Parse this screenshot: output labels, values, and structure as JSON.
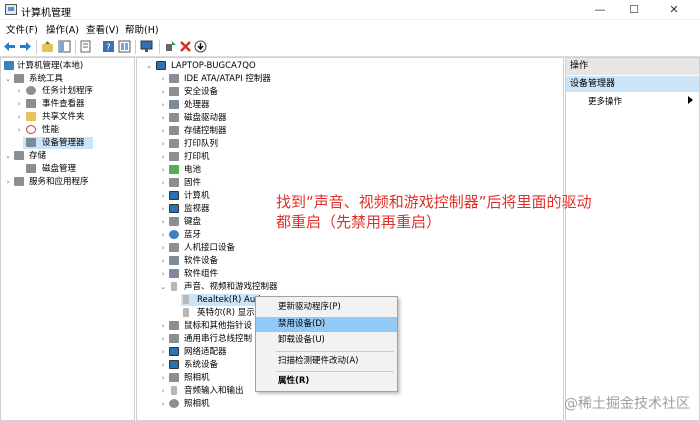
{
  "window": {
    "title": "计算机管理",
    "minimize": "—",
    "maximize": "☐",
    "close": "✕"
  },
  "menu": [
    "文件(F)",
    "操作(A)",
    "查看(V)",
    "帮助(H)"
  ],
  "left_tree": [
    {
      "label": "计算机管理(本地)",
      "icon": "computer-management-icon"
    },
    {
      "label": "系统工具",
      "icon": "tools-icon"
    },
    {
      "label": "任务计划程序",
      "icon": "clock-icon"
    },
    {
      "label": "事件查看器",
      "icon": "event-viewer-icon"
    },
    {
      "label": "共享文件夹",
      "icon": "folder-icon"
    },
    {
      "label": "性能",
      "icon": "performance-icon"
    },
    {
      "label": "设备管理器",
      "icon": "device-manager-icon"
    },
    {
      "label": "存储",
      "icon": "storage-icon"
    },
    {
      "label": "磁盘管理",
      "icon": "disk-icon"
    },
    {
      "label": "服务和应用程序",
      "icon": "services-icon"
    }
  ],
  "device_tree": {
    "root": "LAPTOP-BUGCA7QO",
    "items": [
      "IDE ATA/ATAPI 控制器",
      "安全设备",
      "处理器",
      "磁盘驱动器",
      "存储控制器",
      "打印队列",
      "打印机",
      "电池",
      "固件",
      "计算机",
      "监视器",
      "键盘",
      "蓝牙",
      "人机接口设备",
      "软件设备",
      "软件组件",
      "声音、视频和游戏控制器"
    ],
    "sound_children": [
      "Realtek(R) Aud",
      "英特尔(R) 显示"
    ],
    "items_after": [
      "鼠标和其他指针设",
      "通用串行总线控制",
      "网络适配器",
      "系统设备",
      "照相机",
      "音频输入和输出",
      "照相机"
    ]
  },
  "context_menu": [
    "更新驱动程序(P)",
    "禁用设备(D)",
    "卸载设备(U)",
    "扫描检测硬件改动(A)",
    "属性(R)"
  ],
  "actions_panel": {
    "title": "操作",
    "section": "设备管理器",
    "more": "更多操作"
  },
  "annotation": [
    "找到“声音、视频和游戏控制器”后将里面的驱动",
    "都重启（先禁用再重启）"
  ],
  "watermark": "@稀土掘金技术社区",
  "colors": {
    "annotation": "#e0302a",
    "selection": "#cce4f7",
    "menu_highlight": "#91c9f7"
  }
}
